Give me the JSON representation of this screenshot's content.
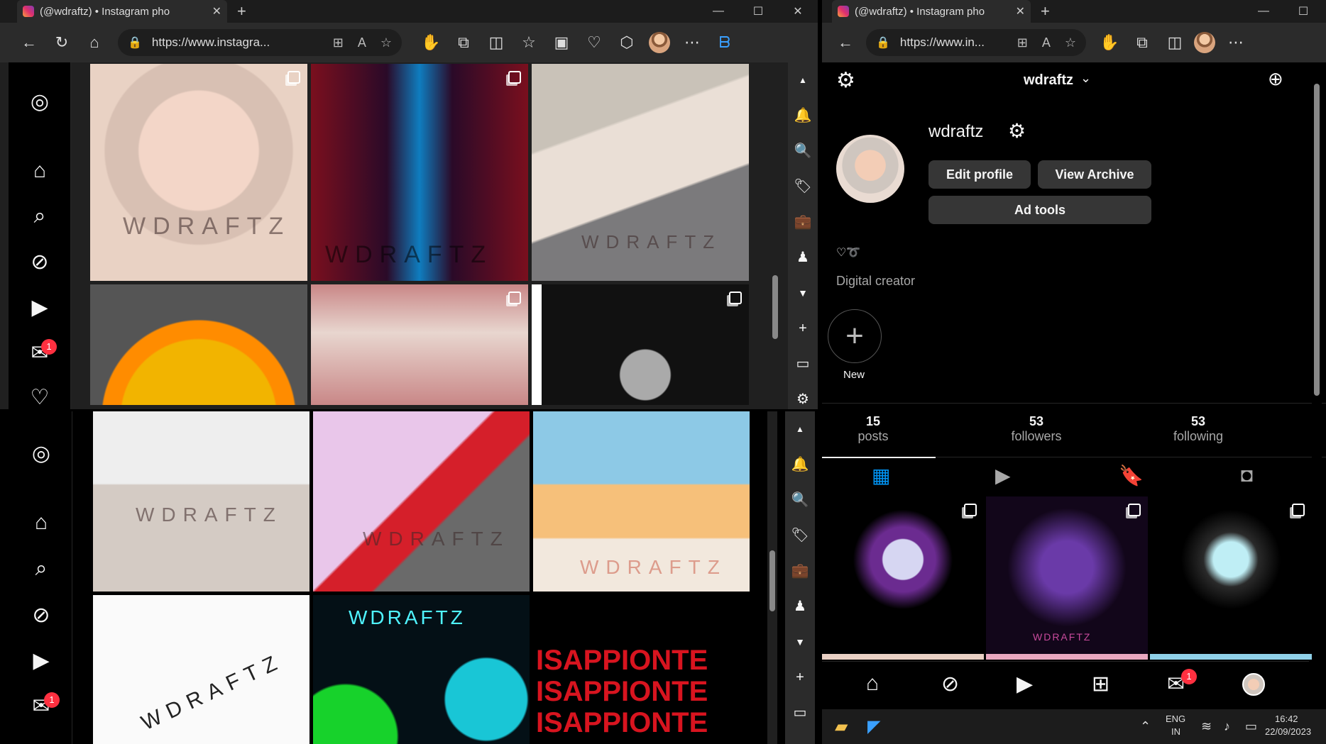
{
  "left_browser": {
    "tab_title": "(@wdraftz) • Instagram pho",
    "url": "https://www.instagra...",
    "watermark": "WDRAFTZ"
  },
  "left_browser_2": {
    "watermark": "WDRAFTZ",
    "tile_text_1": "WDRAFTZ",
    "tile_text_2": "ISAPPIONTE"
  },
  "right_browser": {
    "tab_title": "(@wdraftz) • Instagram pho",
    "url": "https://www.in..."
  },
  "profile": {
    "username_header": "wdraftz",
    "username": "wdraftz",
    "edit_profile": "Edit profile",
    "view_archive": "View Archive",
    "ad_tools": "Ad tools",
    "bio_emoji": "♡➰",
    "category": "Digital creator",
    "highlight_new": "New",
    "stats": [
      {
        "n": "15",
        "l": "posts"
      },
      {
        "n": "53",
        "l": "followers"
      },
      {
        "n": "53",
        "l": "following"
      }
    ],
    "tile_text": "WDRAFTZ"
  },
  "badges": {
    "messages": "1"
  },
  "taskbar": {
    "lang1": "ENG",
    "lang2": "IN",
    "time": "16:42",
    "date": "22/09/2023"
  },
  "colors": {
    "accent": "#0095f6",
    "badge": "#ff3040"
  }
}
